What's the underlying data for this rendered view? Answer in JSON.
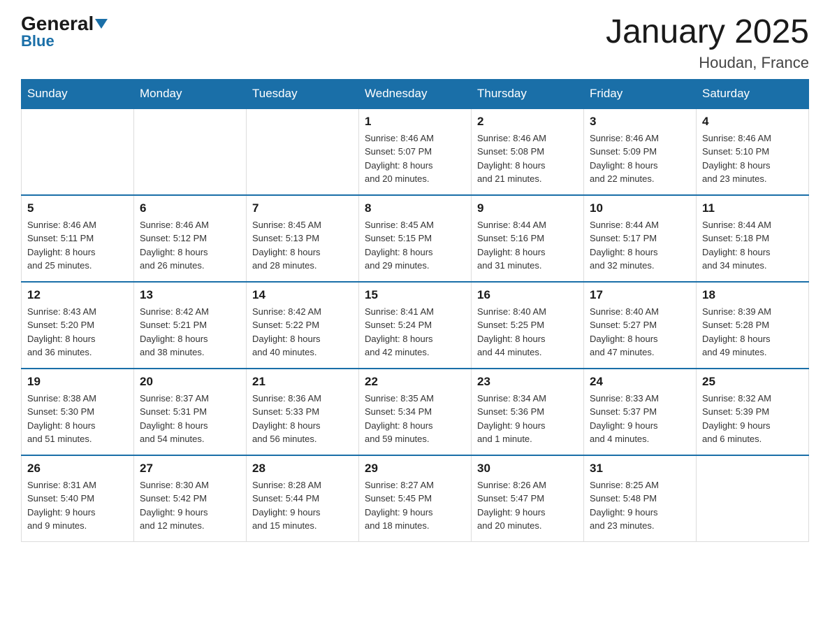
{
  "logo": {
    "general": "General",
    "blue": "Blue"
  },
  "header": {
    "title": "January 2025",
    "location": "Houdan, France"
  },
  "weekdays": [
    "Sunday",
    "Monday",
    "Tuesday",
    "Wednesday",
    "Thursday",
    "Friday",
    "Saturday"
  ],
  "weeks": [
    [
      {
        "day": "",
        "info": ""
      },
      {
        "day": "",
        "info": ""
      },
      {
        "day": "",
        "info": ""
      },
      {
        "day": "1",
        "info": "Sunrise: 8:46 AM\nSunset: 5:07 PM\nDaylight: 8 hours\nand 20 minutes."
      },
      {
        "day": "2",
        "info": "Sunrise: 8:46 AM\nSunset: 5:08 PM\nDaylight: 8 hours\nand 21 minutes."
      },
      {
        "day": "3",
        "info": "Sunrise: 8:46 AM\nSunset: 5:09 PM\nDaylight: 8 hours\nand 22 minutes."
      },
      {
        "day": "4",
        "info": "Sunrise: 8:46 AM\nSunset: 5:10 PM\nDaylight: 8 hours\nand 23 minutes."
      }
    ],
    [
      {
        "day": "5",
        "info": "Sunrise: 8:46 AM\nSunset: 5:11 PM\nDaylight: 8 hours\nand 25 minutes."
      },
      {
        "day": "6",
        "info": "Sunrise: 8:46 AM\nSunset: 5:12 PM\nDaylight: 8 hours\nand 26 minutes."
      },
      {
        "day": "7",
        "info": "Sunrise: 8:45 AM\nSunset: 5:13 PM\nDaylight: 8 hours\nand 28 minutes."
      },
      {
        "day": "8",
        "info": "Sunrise: 8:45 AM\nSunset: 5:15 PM\nDaylight: 8 hours\nand 29 minutes."
      },
      {
        "day": "9",
        "info": "Sunrise: 8:44 AM\nSunset: 5:16 PM\nDaylight: 8 hours\nand 31 minutes."
      },
      {
        "day": "10",
        "info": "Sunrise: 8:44 AM\nSunset: 5:17 PM\nDaylight: 8 hours\nand 32 minutes."
      },
      {
        "day": "11",
        "info": "Sunrise: 8:44 AM\nSunset: 5:18 PM\nDaylight: 8 hours\nand 34 minutes."
      }
    ],
    [
      {
        "day": "12",
        "info": "Sunrise: 8:43 AM\nSunset: 5:20 PM\nDaylight: 8 hours\nand 36 minutes."
      },
      {
        "day": "13",
        "info": "Sunrise: 8:42 AM\nSunset: 5:21 PM\nDaylight: 8 hours\nand 38 minutes."
      },
      {
        "day": "14",
        "info": "Sunrise: 8:42 AM\nSunset: 5:22 PM\nDaylight: 8 hours\nand 40 minutes."
      },
      {
        "day": "15",
        "info": "Sunrise: 8:41 AM\nSunset: 5:24 PM\nDaylight: 8 hours\nand 42 minutes."
      },
      {
        "day": "16",
        "info": "Sunrise: 8:40 AM\nSunset: 5:25 PM\nDaylight: 8 hours\nand 44 minutes."
      },
      {
        "day": "17",
        "info": "Sunrise: 8:40 AM\nSunset: 5:27 PM\nDaylight: 8 hours\nand 47 minutes."
      },
      {
        "day": "18",
        "info": "Sunrise: 8:39 AM\nSunset: 5:28 PM\nDaylight: 8 hours\nand 49 minutes."
      }
    ],
    [
      {
        "day": "19",
        "info": "Sunrise: 8:38 AM\nSunset: 5:30 PM\nDaylight: 8 hours\nand 51 minutes."
      },
      {
        "day": "20",
        "info": "Sunrise: 8:37 AM\nSunset: 5:31 PM\nDaylight: 8 hours\nand 54 minutes."
      },
      {
        "day": "21",
        "info": "Sunrise: 8:36 AM\nSunset: 5:33 PM\nDaylight: 8 hours\nand 56 minutes."
      },
      {
        "day": "22",
        "info": "Sunrise: 8:35 AM\nSunset: 5:34 PM\nDaylight: 8 hours\nand 59 minutes."
      },
      {
        "day": "23",
        "info": "Sunrise: 8:34 AM\nSunset: 5:36 PM\nDaylight: 9 hours\nand 1 minute."
      },
      {
        "day": "24",
        "info": "Sunrise: 8:33 AM\nSunset: 5:37 PM\nDaylight: 9 hours\nand 4 minutes."
      },
      {
        "day": "25",
        "info": "Sunrise: 8:32 AM\nSunset: 5:39 PM\nDaylight: 9 hours\nand 6 minutes."
      }
    ],
    [
      {
        "day": "26",
        "info": "Sunrise: 8:31 AM\nSunset: 5:40 PM\nDaylight: 9 hours\nand 9 minutes."
      },
      {
        "day": "27",
        "info": "Sunrise: 8:30 AM\nSunset: 5:42 PM\nDaylight: 9 hours\nand 12 minutes."
      },
      {
        "day": "28",
        "info": "Sunrise: 8:28 AM\nSunset: 5:44 PM\nDaylight: 9 hours\nand 15 minutes."
      },
      {
        "day": "29",
        "info": "Sunrise: 8:27 AM\nSunset: 5:45 PM\nDaylight: 9 hours\nand 18 minutes."
      },
      {
        "day": "30",
        "info": "Sunrise: 8:26 AM\nSunset: 5:47 PM\nDaylight: 9 hours\nand 20 minutes."
      },
      {
        "day": "31",
        "info": "Sunrise: 8:25 AM\nSunset: 5:48 PM\nDaylight: 9 hours\nand 23 minutes."
      },
      {
        "day": "",
        "info": ""
      }
    ]
  ]
}
